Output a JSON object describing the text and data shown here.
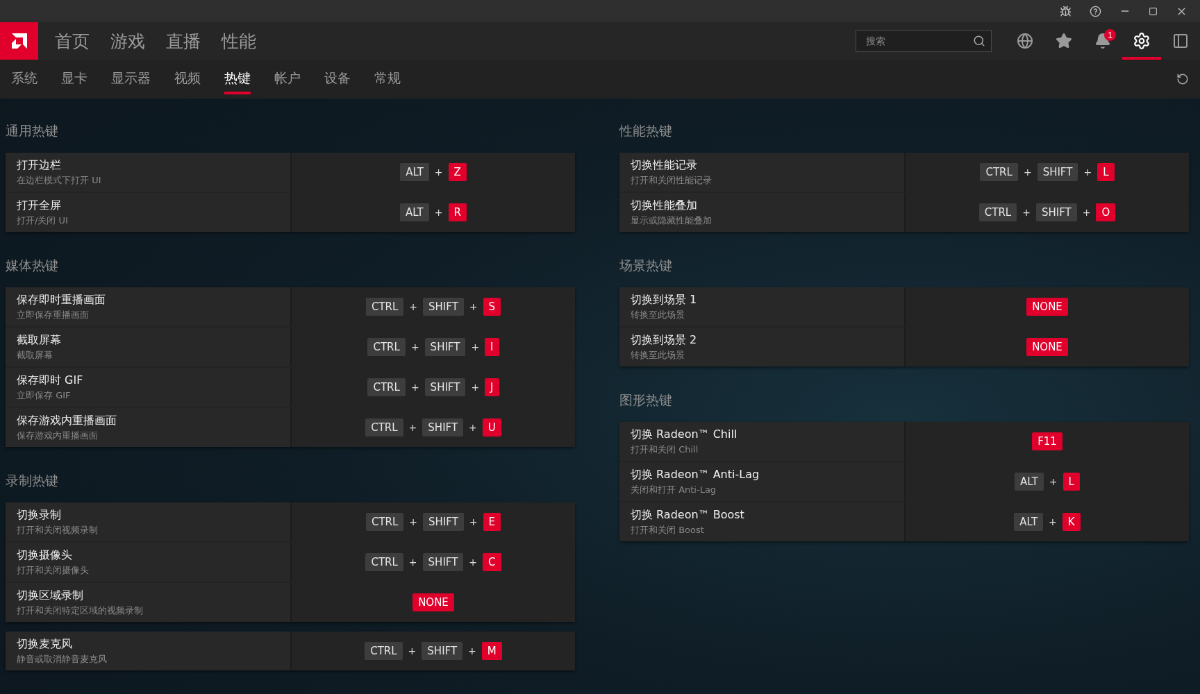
{
  "nav": {
    "items": [
      {
        "label": "首页",
        "selected": false
      },
      {
        "label": "游戏",
        "selected": false
      },
      {
        "label": "直播",
        "selected": false
      },
      {
        "label": "性能",
        "selected": false
      }
    ],
    "search": {
      "placeholder": "搜索"
    },
    "notification_count": "1",
    "settings_selected": true
  },
  "tabs": [
    {
      "label": "系统",
      "selected": false
    },
    {
      "label": "显卡",
      "selected": false
    },
    {
      "label": "显示器",
      "selected": false
    },
    {
      "label": "视频",
      "selected": false
    },
    {
      "label": "热键",
      "selected": true
    },
    {
      "label": "帐户",
      "selected": false
    },
    {
      "label": "设备",
      "selected": false
    },
    {
      "label": "常规",
      "selected": false
    }
  ],
  "columns": [
    {
      "sections": [
        {
          "title": "通用热键",
          "cards": [
            [
              {
                "name": "打开边栏",
                "desc": "在边栏模式下打开 UI",
                "keys": [
                  {
                    "label": "ALT",
                    "kind": "mod"
                  },
                  {
                    "label": "+",
                    "kind": "plus"
                  },
                  {
                    "label": "Z",
                    "kind": "key"
                  }
                ]
              },
              {
                "name": "打开全屏",
                "desc": "打开/关闭 UI",
                "keys": [
                  {
                    "label": "ALT",
                    "kind": "mod"
                  },
                  {
                    "label": "+",
                    "kind": "plus"
                  },
                  {
                    "label": "R",
                    "kind": "key"
                  }
                ]
              }
            ]
          ]
        },
        {
          "title": "媒体热键",
          "cards": [
            [
              {
                "name": "保存即时重播画面",
                "desc": "立即保存重播画面",
                "keys": [
                  {
                    "label": "CTRL",
                    "kind": "mod"
                  },
                  {
                    "label": "+",
                    "kind": "plus"
                  },
                  {
                    "label": "SHIFT",
                    "kind": "mod"
                  },
                  {
                    "label": "+",
                    "kind": "plus"
                  },
                  {
                    "label": "S",
                    "kind": "key"
                  }
                ]
              },
              {
                "name": "截取屏幕",
                "desc": "截取屏幕",
                "keys": [
                  {
                    "label": "CTRL",
                    "kind": "mod"
                  },
                  {
                    "label": "+",
                    "kind": "plus"
                  },
                  {
                    "label": "SHIFT",
                    "kind": "mod"
                  },
                  {
                    "label": "+",
                    "kind": "plus"
                  },
                  {
                    "label": "I",
                    "kind": "key"
                  }
                ]
              },
              {
                "name": "保存即时 GIF",
                "desc": "立即保存 GIF",
                "keys": [
                  {
                    "label": "CTRL",
                    "kind": "mod"
                  },
                  {
                    "label": "+",
                    "kind": "plus"
                  },
                  {
                    "label": "SHIFT",
                    "kind": "mod"
                  },
                  {
                    "label": "+",
                    "kind": "plus"
                  },
                  {
                    "label": "J",
                    "kind": "key"
                  }
                ]
              },
              {
                "name": "保存游戏内重播画面",
                "desc": "保存游戏内重播画面",
                "keys": [
                  {
                    "label": "CTRL",
                    "kind": "mod"
                  },
                  {
                    "label": "+",
                    "kind": "plus"
                  },
                  {
                    "label": "SHIFT",
                    "kind": "mod"
                  },
                  {
                    "label": "+",
                    "kind": "plus"
                  },
                  {
                    "label": "U",
                    "kind": "key"
                  }
                ]
              }
            ]
          ]
        },
        {
          "title": "录制热键",
          "cards": [
            [
              {
                "name": "切换录制",
                "desc": "打开和关闭视频录制",
                "keys": [
                  {
                    "label": "CTRL",
                    "kind": "mod"
                  },
                  {
                    "label": "+",
                    "kind": "plus"
                  },
                  {
                    "label": "SHIFT",
                    "kind": "mod"
                  },
                  {
                    "label": "+",
                    "kind": "plus"
                  },
                  {
                    "label": "E",
                    "kind": "key"
                  }
                ]
              },
              {
                "name": "切换摄像头",
                "desc": "打开和关闭摄像头",
                "keys": [
                  {
                    "label": "CTRL",
                    "kind": "mod"
                  },
                  {
                    "label": "+",
                    "kind": "plus"
                  },
                  {
                    "label": "SHIFT",
                    "kind": "mod"
                  },
                  {
                    "label": "+",
                    "kind": "plus"
                  },
                  {
                    "label": "C",
                    "kind": "key"
                  }
                ]
              },
              {
                "name": "切换区域录制",
                "desc": "打开和关闭特定区域的视频录制",
                "keys": [
                  {
                    "label": "NONE",
                    "kind": "key"
                  }
                ]
              }
            ],
            [
              {
                "name": "切换麦克风",
                "desc": "静音或取消静音麦克风",
                "keys": [
                  {
                    "label": "CTRL",
                    "kind": "mod"
                  },
                  {
                    "label": "+",
                    "kind": "plus"
                  },
                  {
                    "label": "SHIFT",
                    "kind": "mod"
                  },
                  {
                    "label": "+",
                    "kind": "plus"
                  },
                  {
                    "label": "M",
                    "kind": "key"
                  }
                ]
              }
            ]
          ]
        }
      ]
    },
    {
      "sections": [
        {
          "title": "性能热键",
          "cards": [
            [
              {
                "name": "切换性能记录",
                "desc": "打开和关闭性能记录",
                "keys": [
                  {
                    "label": "CTRL",
                    "kind": "mod"
                  },
                  {
                    "label": "+",
                    "kind": "plus"
                  },
                  {
                    "label": "SHIFT",
                    "kind": "mod"
                  },
                  {
                    "label": "+",
                    "kind": "plus"
                  },
                  {
                    "label": "L",
                    "kind": "key"
                  }
                ]
              },
              {
                "name": "切换性能叠加",
                "desc": "显示或隐藏性能叠加",
                "keys": [
                  {
                    "label": "CTRL",
                    "kind": "mod"
                  },
                  {
                    "label": "+",
                    "kind": "plus"
                  },
                  {
                    "label": "SHIFT",
                    "kind": "mod"
                  },
                  {
                    "label": "+",
                    "kind": "plus"
                  },
                  {
                    "label": "O",
                    "kind": "key"
                  }
                ]
              }
            ]
          ]
        },
        {
          "title": "场景热键",
          "cards": [
            [
              {
                "name": "切换到场景 1",
                "desc": "转换至此场景",
                "keys": [
                  {
                    "label": "NONE",
                    "kind": "key"
                  }
                ]
              },
              {
                "name": "切换到场景 2",
                "desc": "转换至此场景",
                "keys": [
                  {
                    "label": "NONE",
                    "kind": "key"
                  }
                ]
              }
            ]
          ]
        },
        {
          "title": "图形热键",
          "cards": [
            [
              {
                "name": "切换 Radeon™ Chill",
                "desc": "打开和关闭 Chill",
                "keys": [
                  {
                    "label": "F11",
                    "kind": "key"
                  }
                ]
              },
              {
                "name": "切换 Radeon™ Anti-Lag",
                "desc": "关闭和打开 Anti-Lag",
                "keys": [
                  {
                    "label": "ALT",
                    "kind": "mod"
                  },
                  {
                    "label": "+",
                    "kind": "plus"
                  },
                  {
                    "label": "L",
                    "kind": "key"
                  }
                ]
              },
              {
                "name": "切换 Radeon™ Boost",
                "desc": "打开和关闭 Boost",
                "keys": [
                  {
                    "label": "ALT",
                    "kind": "mod"
                  },
                  {
                    "label": "+",
                    "kind": "plus"
                  },
                  {
                    "label": "K",
                    "kind": "key"
                  }
                ]
              }
            ]
          ]
        }
      ]
    }
  ]
}
